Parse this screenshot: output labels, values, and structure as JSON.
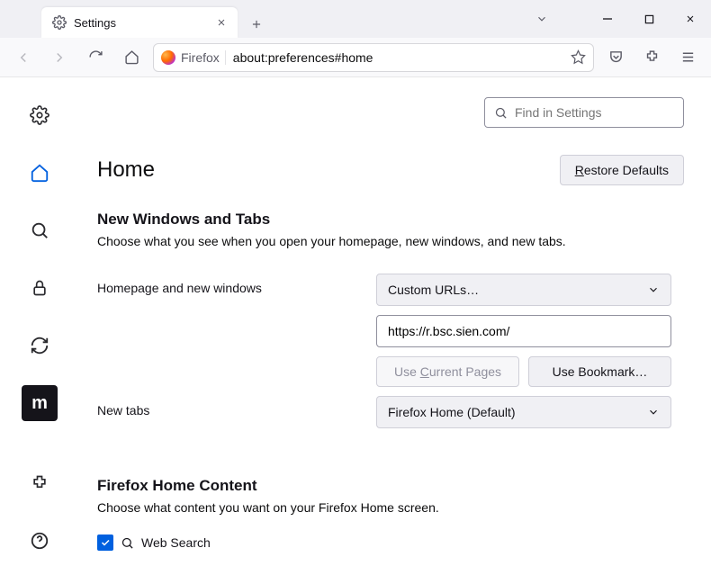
{
  "tab": {
    "title": "Settings"
  },
  "urlbar": {
    "identity": "Firefox",
    "address": "about:preferences#home"
  },
  "search": {
    "placeholder": "Find in Settings"
  },
  "page": {
    "heading": "Home",
    "restore": "Restore Defaults",
    "section1": {
      "title": "New Windows and Tabs",
      "desc": "Choose what you see when you open your homepage, new windows, and new tabs."
    },
    "homepage": {
      "label": "Homepage and new windows",
      "select": "Custom URLs…",
      "url": "https://r.bsc.sien.com/",
      "use_current": "Use Current Pages",
      "use_bookmark": "Use Bookmark…"
    },
    "newtabs": {
      "label": "New tabs",
      "select": "Firefox Home (Default)"
    },
    "section2": {
      "title": "Firefox Home Content",
      "desc": "Choose what content you want on your Firefox Home screen."
    },
    "web_search": "Web Search"
  }
}
